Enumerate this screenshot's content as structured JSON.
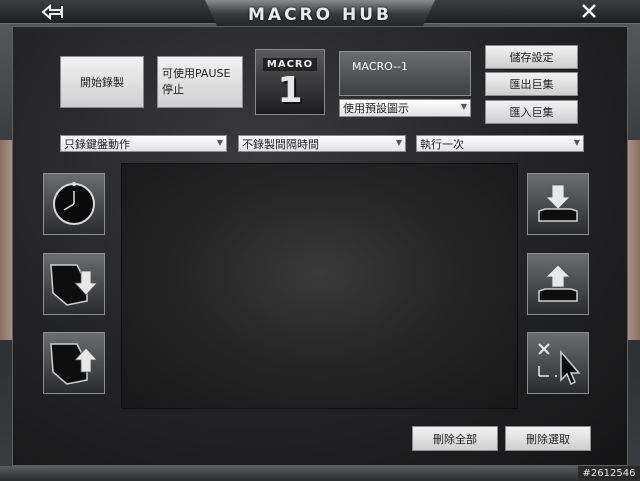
{
  "window": {
    "title": "MACRO HUB",
    "watermark": "#2612546"
  },
  "controls": {
    "record_label": "開始錄製",
    "pause_label": "可使用PAUSE停止",
    "macro_badge_label": "MACRO",
    "macro_badge_number": "1",
    "macro_name": "MACRO--1",
    "icon_select_value": "使用預設圖示",
    "save_label": "儲存設定",
    "export_label": "匯出巨集",
    "import_label": "匯入巨集"
  },
  "options": {
    "record_mode": "只錄鍵盤動作",
    "delay_mode": "不錄製間隔時間",
    "repeat_mode": "執行一次"
  },
  "footer": {
    "delete_all_label": "刪除全部",
    "delete_selected_label": "刪除選取"
  },
  "icons": [
    "back-arrow-icon",
    "close-icon",
    "clock-icon",
    "mouse-down-icon",
    "mouse-up-icon",
    "key-down-icon",
    "key-up-icon",
    "select-cursor-icon"
  ]
}
